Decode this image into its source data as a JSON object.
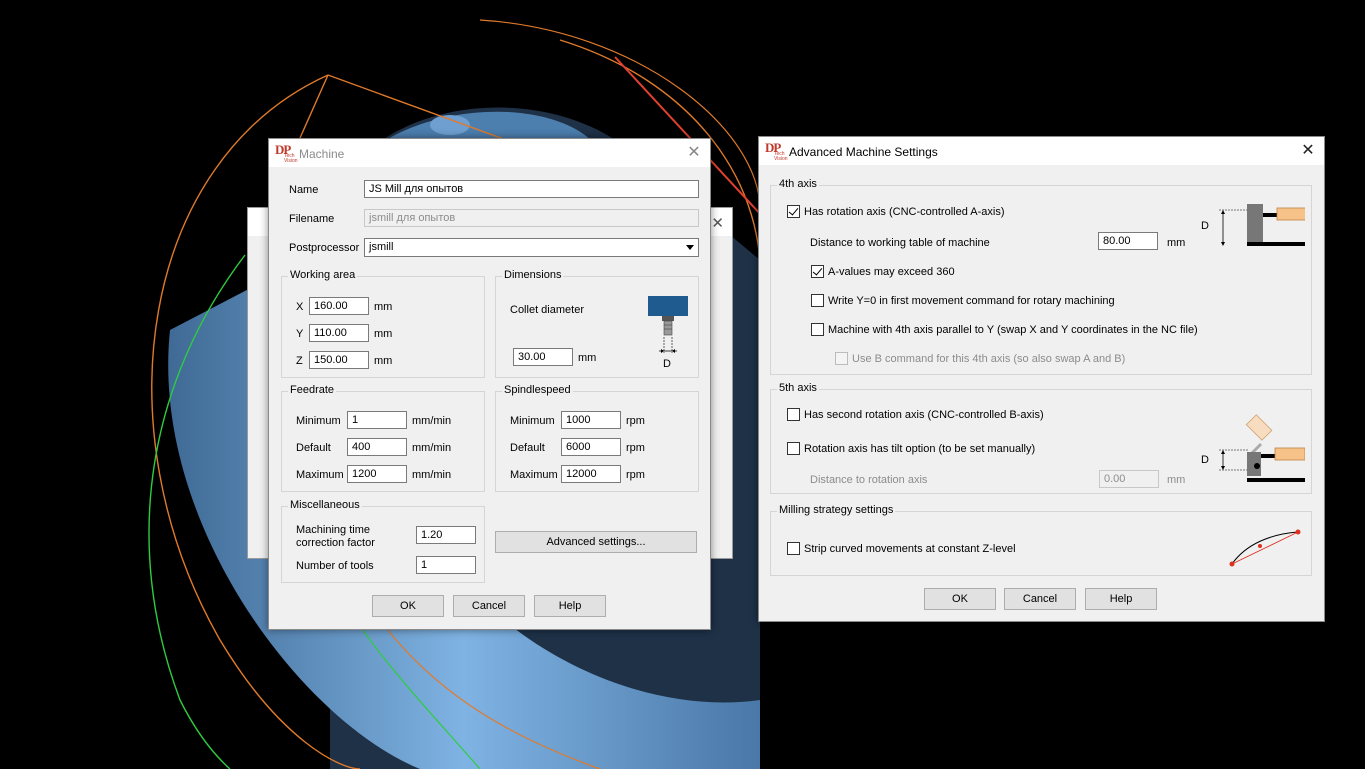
{
  "machine": {
    "title": "Machine",
    "logo": {
      "dp": "DP",
      "sub": "Tech Vision"
    },
    "close": "✕",
    "name_label": "Name",
    "name_value": "JS Mill для  опытов",
    "filename_label": "Filename",
    "filename_value": "jsmill  для  опытов",
    "postprocessor_label": "Postprocessor",
    "postprocessor_value": "jsmill",
    "working_area": {
      "title": "Working area",
      "x_label": "X",
      "x_value": "160.00",
      "y_label": "Y",
      "y_value": "110.00",
      "z_label": "Z",
      "z_value": "150.00",
      "unit": "mm"
    },
    "dimensions": {
      "title": "Dimensions",
      "collet_label": "Collet diameter",
      "collet_value": "30.00",
      "unit": "mm",
      "d_label": "D"
    },
    "feedrate": {
      "title": "Feedrate",
      "min_label": "Minimum",
      "min_value": "1",
      "def_label": "Default",
      "def_value": "400",
      "max_label": "Maximum",
      "max_value": "1200",
      "unit": "mm/min"
    },
    "spindlespeed": {
      "title": "Spindlespeed",
      "min_label": "Minimum",
      "min_value": "1000",
      "def_label": "Default",
      "def_value": "6000",
      "max_label": "Maximum",
      "max_value": "12000",
      "unit": "rpm"
    },
    "misc": {
      "title": "Miscellaneous",
      "mtcf_label_1": "Machining time",
      "mtcf_label_2": "correction factor",
      "mtcf_value": "1.20",
      "tools_label": "Number of tools",
      "tools_value": "1"
    },
    "advanced_button": "Advanced settings...",
    "ok": "OK",
    "cancel": "Cancel",
    "help": "Help"
  },
  "advanced": {
    "title": "Advanced Machine Settings",
    "close": "✕",
    "axis4": {
      "title": "4th axis",
      "has_rotation": "Has rotation axis (CNC-controlled A-axis)",
      "has_rotation_checked": true,
      "distance_label": "Distance to working table of machine",
      "distance_value": "80.00",
      "unit": "mm",
      "a_exceed": "A-values may exceed 360",
      "a_exceed_checked": true,
      "write_y0": "Write Y=0 in first movement command for rotary machining",
      "parallel_y": "Machine with 4th axis parallel to Y (swap X and Y coordinates in the NC file)",
      "use_b": "Use B command for this 4th axis (so also swap A and B)",
      "d_label": "D"
    },
    "axis5": {
      "title": "5th axis",
      "second_rotation": "Has second rotation axis (CNC-controlled B-axis)",
      "tilt": "Rotation axis has tilt option (to be set manually)",
      "distance_label": "Distance to rotation axis",
      "distance_value": "0.00",
      "unit": "mm",
      "d_label": "D"
    },
    "milling": {
      "title": "Milling strategy settings",
      "strip": "Strip curved movements at constant Z-level"
    },
    "ok": "OK",
    "cancel": "Cancel",
    "help": "Help"
  },
  "colors": {
    "accent_orange": "#f0c080",
    "arrow_red": "#e04030",
    "part_blue": "#7aa9d8"
  }
}
